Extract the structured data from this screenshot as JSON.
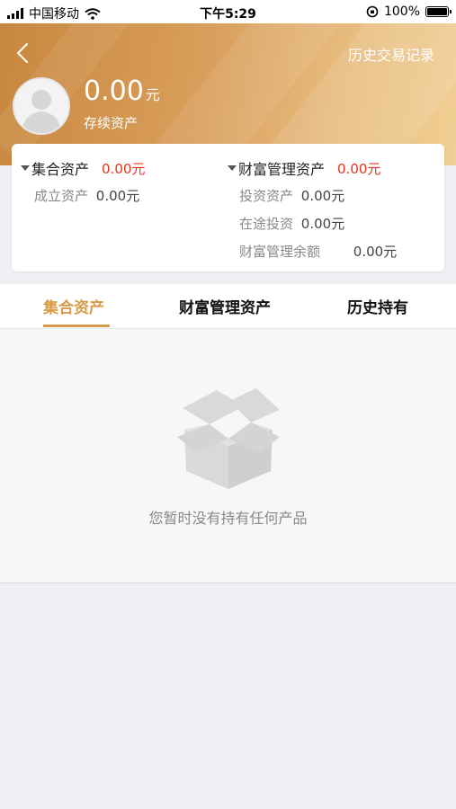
{
  "status_bar": {
    "carrier": "中国移动",
    "time": "下午5:29",
    "battery": "100%"
  },
  "header": {
    "history_link": "历史交易记录",
    "total_amount": "0.00",
    "total_unit": "元",
    "total_label": "存续资产"
  },
  "summary": {
    "collective": {
      "title": "集合资产",
      "amount": "0.00元",
      "rows": [
        {
          "label": "成立资产",
          "value": "0.00元"
        }
      ]
    },
    "wealth": {
      "title": "财富管理资产",
      "amount": "0.00元",
      "rows": [
        {
          "label": "投资资产",
          "value": "0.00元"
        },
        {
          "label": "在途投资",
          "value": "0.00元"
        },
        {
          "label": "财富管理余额",
          "value": "0.00元"
        }
      ]
    }
  },
  "tabs": [
    {
      "label": "集合资产",
      "active": true
    },
    {
      "label": "财富管理资产",
      "active": false
    },
    {
      "label": "历史持有",
      "active": false
    }
  ],
  "empty_state": {
    "message": "您暂时没有持有任何产品",
    "icon": "empty-box-icon"
  },
  "colors": {
    "accent": "#d89a47",
    "highlight_red": "#e8321f",
    "header_start": "#c8873e",
    "header_end": "#f1cf94"
  }
}
